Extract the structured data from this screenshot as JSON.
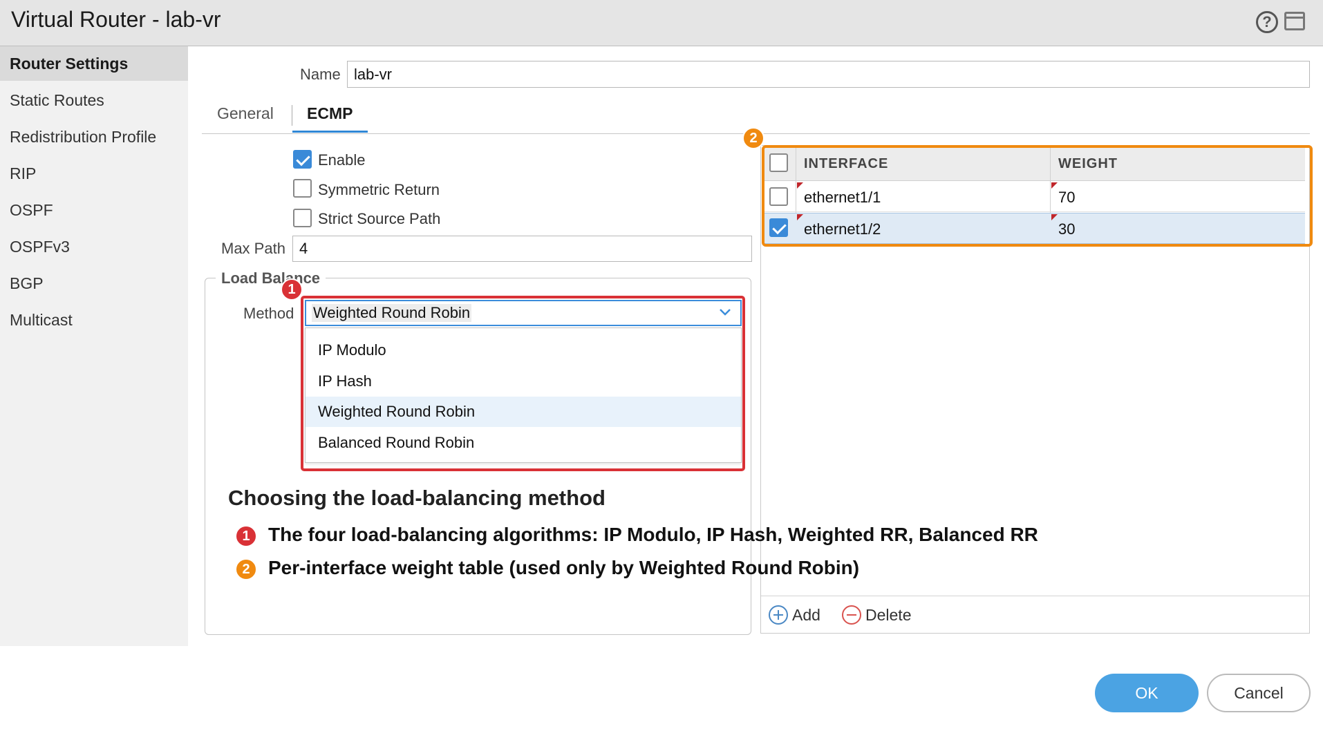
{
  "window": {
    "title": "Virtual Router - lab-vr",
    "help_icon": "?"
  },
  "sidebar": {
    "items": [
      {
        "label": "Router Settings",
        "active": true
      },
      {
        "label": "Static Routes"
      },
      {
        "label": "Redistribution Profile"
      },
      {
        "label": "RIP"
      },
      {
        "label": "OSPF"
      },
      {
        "label": "OSPFv3"
      },
      {
        "label": "BGP"
      },
      {
        "label": "Multicast"
      }
    ]
  },
  "form": {
    "name_label": "Name",
    "name_value": "lab-vr",
    "tabs": [
      "General",
      "ECMP"
    ],
    "active_tab": "ECMP"
  },
  "ecmp": {
    "enable_label": "Enable",
    "enable_checked": true,
    "symmetric_return_label": "Symmetric Return",
    "symmetric_return_checked": false,
    "strict_source_path_label": "Strict Source Path",
    "strict_source_path_checked": false,
    "max_path_label": "Max Path",
    "max_path_value": "4",
    "load_balance_legend": "Load Balance",
    "method_label": "Method",
    "method_value": "Weighted Round Robin",
    "method_options": [
      "IP Modulo",
      "IP Hash",
      "Weighted Round Robin",
      "Balanced Round Robin"
    ],
    "selected_option_index": 2
  },
  "interface_table": {
    "headers": {
      "interface": "INTERFACE",
      "weight": "WEIGHT"
    },
    "rows": [
      {
        "interface": "ethernet1/1",
        "weight": "70",
        "checked": false
      },
      {
        "interface": "ethernet1/2",
        "weight": "30",
        "checked": true
      }
    ],
    "add_label": "Add",
    "delete_label": "Delete"
  },
  "annotations": {
    "heading": "Choosing the load-balancing method",
    "items": [
      {
        "badge": "1",
        "text": "The four load-balancing algorithms: IP Modulo, IP Hash, Weighted RR, Balanced RR",
        "color": "#d93136"
      },
      {
        "badge": "2",
        "text": "Per-interface weight table (used only by Weighted Round Robin)",
        "color": "#f08a10"
      }
    ]
  },
  "buttons": {
    "ok": "OK",
    "cancel": "Cancel"
  },
  "colors": {
    "accent": "#2f87d6",
    "ok_button": "#4ba3e3",
    "highlight_red": "#d93136",
    "highlight_orange": "#f08a10"
  }
}
